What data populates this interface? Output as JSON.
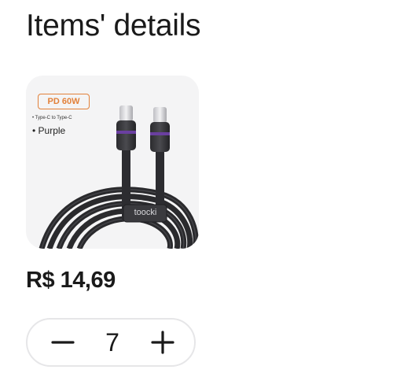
{
  "page": {
    "title": "Items' details"
  },
  "product": {
    "image_badge": "PD 60W",
    "image_spec_line1": "• Type-C to Type-C",
    "image_spec_line2": "• Purple",
    "image_brand": "toocki",
    "price": "R$ 14,69"
  },
  "quantity": {
    "value": "7",
    "minus_icon": "minus-icon",
    "plus_icon": "plus-icon"
  },
  "colors": {
    "badge_accent": "#e2813a",
    "card_background": "#f4f4f5",
    "stepper_border": "#e6e6e8",
    "text": "#1a1a1a"
  }
}
